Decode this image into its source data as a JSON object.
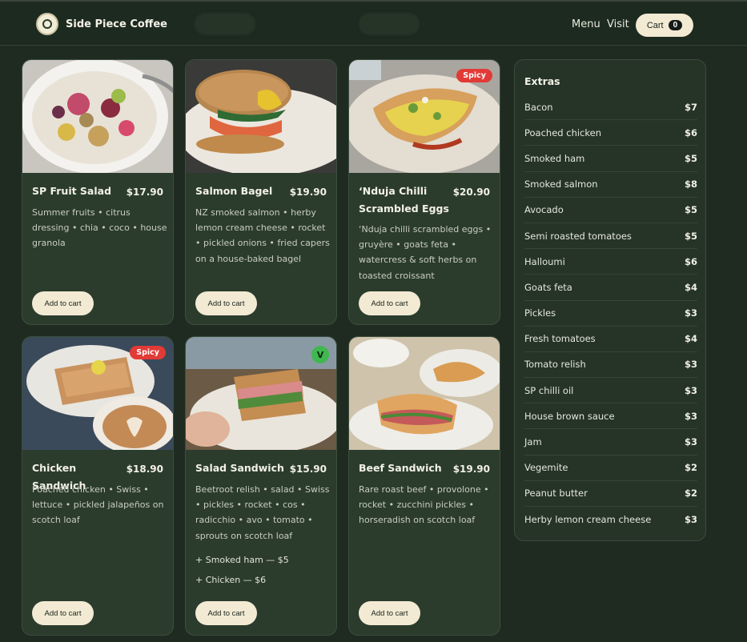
{
  "header": {
    "brand": "Side Piece Coffee",
    "nav": [
      "Menu",
      "Visit"
    ],
    "cart_label": "Cart",
    "cart_count": "0"
  },
  "colors": {
    "background": "#1f2b21",
    "card": "#2b3c2d",
    "button": "#f2ead3",
    "spicy": "#e23a36",
    "vegetarian": "#3fb84f"
  },
  "cards": [
    {
      "title": "SP Fruit Salad",
      "price": "$17.90",
      "desc": "Summer fruits • citrus dressing • chia • coco • house granola",
      "button": "Add to cart"
    },
    {
      "title": "Salmon Bagel",
      "price": "$19.90",
      "desc": "NZ smoked salmon • herby lemon cream cheese • rocket • pickled onions • fried capers on a house-baked bagel",
      "button": "Add to cart"
    },
    {
      "title": "‘Nduja Chilli Scrambled Eggs",
      "price": "$20.90",
      "desc": "‘Nduja chilli scrambled eggs • gruyère • goats feta • watercress & soft herbs on toasted croissant",
      "button": "Add to cart",
      "badge": "Spicy"
    },
    {
      "title": "Chicken Sandwich",
      "price": "$18.90",
      "desc": "Poached chicken • Swiss • lettuce • pickled jalapeños on scotch loaf",
      "button": "Add to cart",
      "badge": "Spicy"
    },
    {
      "title": "Salad Sandwich",
      "price": "$15.90",
      "desc": "Beetroot relish • salad • Swiss • pickles • rocket • cos • radicchio • avo • tomato • sprouts on scotch loaf",
      "button": "Add to cart",
      "badge": "V",
      "addons": [
        "+ Smoked ham — $5",
        "+ Chicken — $6"
      ]
    },
    {
      "title": "Beef Sandwich",
      "price": "$19.90",
      "desc": "Rare roast beef • provolone • rocket • zucchini pickles • horseradish on scotch loaf",
      "button": "Add to cart"
    }
  ],
  "extras": {
    "title": "Extras",
    "items": [
      {
        "name": "Bacon",
        "price": "$7"
      },
      {
        "name": "Poached chicken",
        "price": "$6"
      },
      {
        "name": "Smoked ham",
        "price": "$5"
      },
      {
        "name": "Smoked salmon",
        "price": "$8"
      },
      {
        "name": "Avocado",
        "price": "$5"
      },
      {
        "name": "Semi roasted tomatoes",
        "price": "$5"
      },
      {
        "name": "Halloumi",
        "price": "$6"
      },
      {
        "name": "Goats feta",
        "price": "$4"
      },
      {
        "name": "Pickles",
        "price": "$3"
      },
      {
        "name": "Fresh tomatoes",
        "price": "$4"
      },
      {
        "name": "Tomato relish",
        "price": "$3"
      },
      {
        "name": "SP chilli oil",
        "price": "$3"
      },
      {
        "name": "House brown sauce",
        "price": "$3"
      },
      {
        "name": "Jam",
        "price": "$3"
      },
      {
        "name": "Vegemite",
        "price": "$2"
      },
      {
        "name": "Peanut butter",
        "price": "$2"
      },
      {
        "name": "Herby lemon cream cheese",
        "price": "$3"
      }
    ]
  }
}
